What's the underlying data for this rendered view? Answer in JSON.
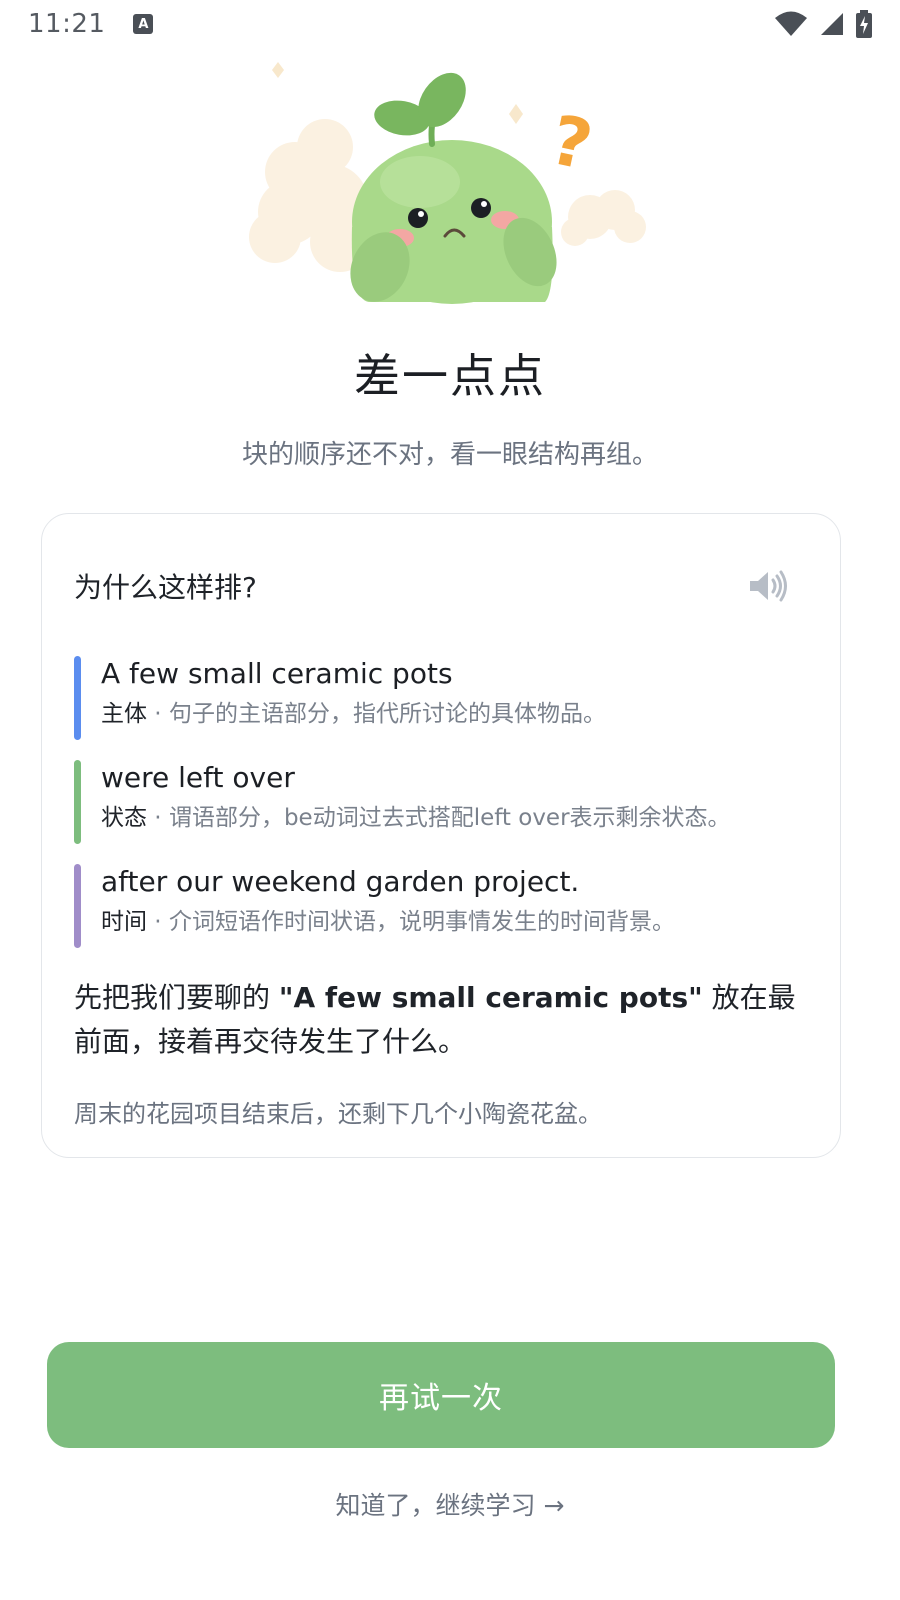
{
  "status_bar": {
    "time": "11:21",
    "icons": [
      "a-notification-icon",
      "wifi-icon",
      "signal-icon",
      "battery-charging-icon"
    ]
  },
  "result": {
    "title": "差一点点",
    "subtitle": "块的顺序还不对，看一眼结构再组。"
  },
  "card": {
    "title": "为什么这样排?",
    "speaker_icon": "speaker-icon",
    "segments": [
      {
        "text": "A few small ceramic pots",
        "role": "主体",
        "separator": " · ",
        "description": "句子的主语部分，指代所讨论的具体物品。",
        "color": "#5b8def"
      },
      {
        "text": "were left over",
        "role": "状态",
        "separator": " · ",
        "description": "谓语部分，be动词过去式搭配left over表示剩余状态。",
        "color": "#7dbd7e"
      },
      {
        "text": "after our weekend garden project.",
        "role": "时间",
        "separator": " · ",
        "description": "介词短语作时间状语，说明事情发生的时间背景。",
        "color": "#a08dc9"
      }
    ],
    "explanation": {
      "before": "先把我们要聊的 ",
      "quote": "\"A few small ceramic pots\"",
      "after": " 放在最前面，接着再交待发生了什么。"
    },
    "translation": "周末的花园项目结束后，还剩下几个小陶瓷花盆。"
  },
  "actions": {
    "retry_label": "再试一次",
    "continue_label": "知道了，继续学习 →"
  },
  "colors": {
    "primary_green": "#7dbd7e",
    "mascot_green": "#a9d98a",
    "question_mark": "#f5a53a"
  }
}
